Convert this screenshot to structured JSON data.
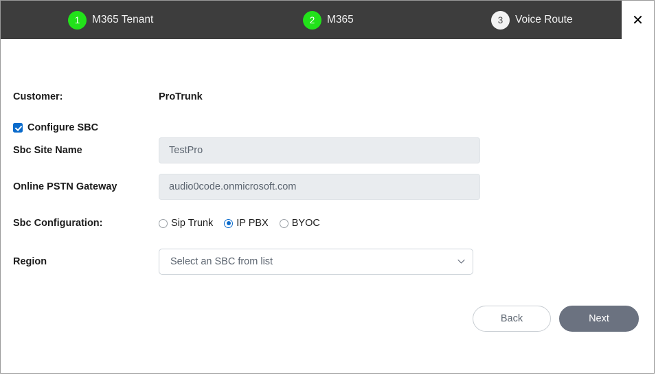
{
  "wizard": {
    "steps": [
      {
        "number": "1",
        "label": "M365 Tenant",
        "state": "done"
      },
      {
        "number": "2",
        "label": "M365",
        "state": "done"
      },
      {
        "number": "3",
        "label": "Voice Route",
        "state": "pending"
      }
    ],
    "close_label": "✕"
  },
  "form": {
    "customer_label": "Customer:",
    "customer_value": "ProTrunk",
    "configure_sbc_label": "Configure SBC",
    "configure_sbc_checked": true,
    "site_name_label": "Sbc Site Name",
    "site_name_value": "TestPro",
    "gateway_label": "Online PSTN Gateway",
    "gateway_value": "audio0code.onmicrosoft.com",
    "sbc_configuration_label": "Sbc Configuration:",
    "sbc_configuration_options": [
      {
        "label": "Sip Trunk",
        "selected": false
      },
      {
        "label": "IP PBX",
        "selected": true
      },
      {
        "label": "BYOC",
        "selected": false
      }
    ],
    "region_label": "Region",
    "region_selected": "Select an SBC from list"
  },
  "footer": {
    "back_label": "Back",
    "next_label": "Next"
  },
  "colors": {
    "header_bg": "#3d3d3d",
    "step_done": "#22e21a",
    "accent_blue": "#0b6bcb",
    "next_button": "#6b7280",
    "input_bg": "#e9ecef"
  }
}
